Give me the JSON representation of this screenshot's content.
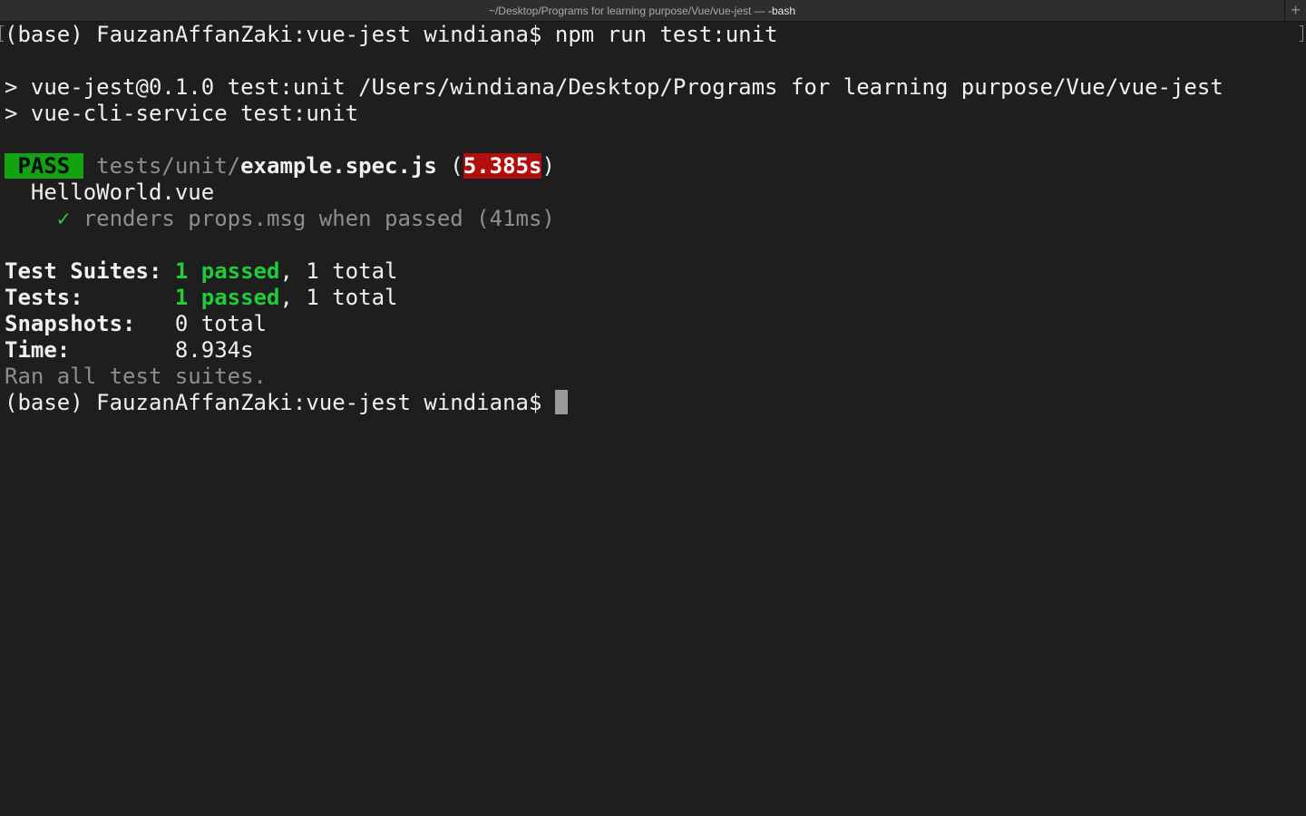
{
  "window": {
    "title_path": "~/Desktop/Programs for learning purpose/Vue/vue-jest — ",
    "title_process": "-bash",
    "new_tab_symbol": "+"
  },
  "terminal": {
    "prompt": "(base) FauzanAffanZaki:vue-jest windiana$ ",
    "command": "npm run test:unit",
    "script_line_1": "> vue-jest@0.1.0 test:unit /Users/windiana/Desktop/Programs for learning purpose/Vue/vue-jest",
    "script_line_2": "> vue-cli-service test:unit",
    "result": {
      "badge": " PASS ",
      "file_dir": "tests/unit/",
      "file_name": "example.spec.js",
      "paren_open": " (",
      "duration": "5.385s",
      "paren_close": ")"
    },
    "suite_name": "  HelloWorld.vue",
    "test_case": {
      "indent": "    ",
      "check": "✓",
      "text": " renders props.msg when passed (41ms)"
    },
    "summary": {
      "suites_label": "Test Suites: ",
      "suites_passed": "1 passed",
      "suites_total": ", 1 total",
      "tests_label": "Tests:       ",
      "tests_passed": "1 passed",
      "tests_total": ", 1 total",
      "snapshots_label": "Snapshots:   ",
      "snapshots_value": "0 total",
      "time_label": "Time:        ",
      "time_value": "8.934s",
      "ran_all": "Ran all test suites."
    },
    "final_prompt": "(base) FauzanAffanZaki:vue-jest windiana$ "
  },
  "colors": {
    "background": "#1e1e1e",
    "pass_badge": "#12a312",
    "slow_time": "#b30e0e",
    "success_text": "#1fcc3a"
  }
}
